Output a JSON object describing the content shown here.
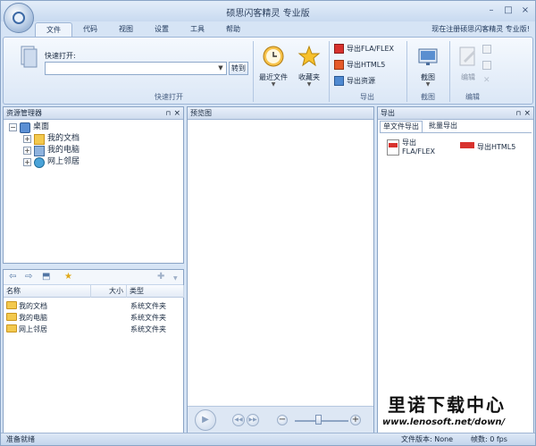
{
  "window": {
    "title": "硕思闪客精灵 专业版",
    "minimize": "–",
    "maximize": "□",
    "close": "×"
  },
  "menu": {
    "tabs": [
      "文件",
      "代码",
      "视图",
      "设置",
      "工具",
      "帮助"
    ],
    "active": "文件",
    "register_text": "现在注册硕思闪客精灵 专业版!"
  },
  "ribbon": {
    "quick_open": {
      "label": "快速打开:",
      "value": "",
      "goto_label": "转到",
      "group_label": "快速打开"
    },
    "recent_label": "最近文件",
    "favorites_label": "收藏夹",
    "export": {
      "fla": "导出FLA/FLEX",
      "html5": "导出HTML5",
      "resources": "导出资源",
      "group_label": "导出"
    },
    "screenshot": {
      "button_label": "截图",
      "group_label": "截图"
    },
    "edit": {
      "button_label": "编辑",
      "group_label": "编辑"
    }
  },
  "resource_manager": {
    "title": "资源管理器",
    "tree": {
      "root": "桌面",
      "items": [
        "我的文档",
        "我的电脑",
        "网上邻居"
      ]
    }
  },
  "file_list": {
    "columns": [
      "名称",
      "大小",
      "类型"
    ],
    "rows": [
      {
        "name": "我的文档",
        "size": "",
        "type": "系统文件夹"
      },
      {
        "name": "我的电脑",
        "size": "",
        "type": "系统文件夹"
      },
      {
        "name": "网上邻居",
        "size": "",
        "type": "系统文件夹"
      }
    ]
  },
  "preview": {
    "title": "预览图"
  },
  "export_panel": {
    "title": "导出",
    "tabs": [
      "单文件导出",
      "批量导出"
    ],
    "fla_line1": "导出",
    "fla_line2": "FLA/FLEX",
    "html5_label": "导出HTML5"
  },
  "statusbar": {
    "left": "准备就绪",
    "version": "文件版本: None",
    "fps": "帧数: 0 fps"
  },
  "watermark": {
    "title": "里诺下载中心",
    "url": "www.lenosoft.net/down/"
  }
}
